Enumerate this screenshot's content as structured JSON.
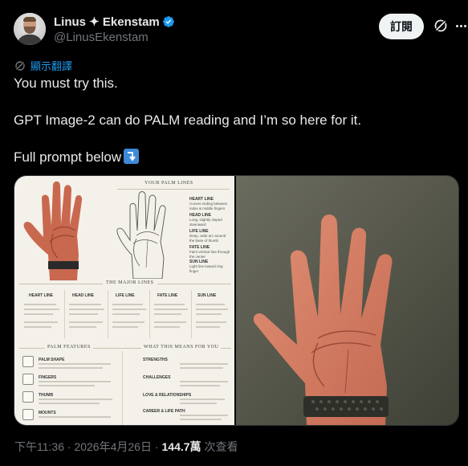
{
  "author": {
    "display_name": "Linus ✦ Ekenstam",
    "handle": "@LinusEkenstam",
    "verified": true
  },
  "actions": {
    "follow_label": "訂閱"
  },
  "translate": {
    "label": "顯示翻譯"
  },
  "tweet": {
    "line1": "You must try this.",
    "line2": "GPT Image-2 can do PALM reading and I’m so here for it.",
    "line3": "Full prompt below"
  },
  "media": {
    "left": {
      "your_palm_lines": "YOUR PALM LINES",
      "heart_line": "HEART LINE",
      "heart_desc": "Curves ending between index & middle fingers",
      "head_line": "HEAD LINE",
      "head_desc": "Long, slightly sloped downward",
      "life_line": "LIFE LINE",
      "life_desc": "Deep, wide arc around the base of thumb",
      "fate_line": "FATE LINE",
      "fate_desc": "Faint vertical line through the center",
      "sun_line": "SUN LINE",
      "sun_desc": "Light line toward ring finger",
      "major_lines": "THE MAJOR LINES",
      "col_heart": "HEART LINE",
      "col_head": "HEAD LINE",
      "col_life": "LIFE LINE",
      "col_fate": "FATE LINE",
      "col_sun": "SUN LINE",
      "palm_features": "PALM FEATURES",
      "palm_shape": "PALM SHAPE",
      "fingers": "FINGERS",
      "thumb": "THUMB",
      "mounts": "MOUNTS",
      "what_this_means": "WHAT THIS MEANS FOR YOU",
      "strengths": "STRENGTHS",
      "challenges": "CHALLENGES",
      "love": "LOVE & RELATIONSHIPS",
      "career": "CAREER & LIFE PATH"
    }
  },
  "footer": {
    "time": "下午11:36 · 2026年4月26日 ·",
    "views": "144.7萬",
    "views_label": "次查看"
  },
  "colors": {
    "accent": "#1d9bf0",
    "verified": "#1d9bf0",
    "background": "#000000",
    "muted": "#71767b"
  }
}
